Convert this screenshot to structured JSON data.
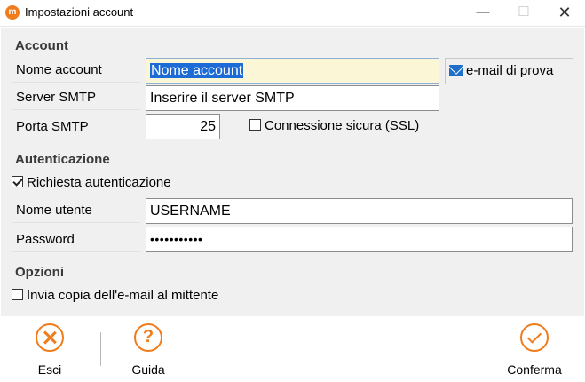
{
  "window": {
    "title": "Impostazioni account",
    "app_icon_glyph": "m",
    "minimize_glyph": "—",
    "maximize_glyph": "☐",
    "close_glyph": "✕"
  },
  "account": {
    "heading": "Account",
    "name_label": "Nome account",
    "name_value": "Nome account",
    "server_label": "Server SMTP",
    "server_value": "Inserire il server SMTP",
    "port_label": "Porta SMTP",
    "port_value": "25",
    "ssl_label": "Connessione sicura (SSL)",
    "ssl_checked": false,
    "test_button": "e-mail di prova"
  },
  "auth": {
    "heading": "Autenticazione",
    "required_label": "Richiesta autenticazione",
    "required_checked": true,
    "user_label": "Nome utente",
    "user_value": "USERNAME",
    "password_label": "Password",
    "password_value": "•••••••••••"
  },
  "options": {
    "heading": "Opzioni",
    "copy_label": "Invia copia dell'e-mail al mittente",
    "copy_checked": false
  },
  "footer": {
    "exit_label": "Esci",
    "help_label": "Guida",
    "help_glyph": "?",
    "confirm_label": "Conferma"
  },
  "colors": {
    "accent": "#f07c1c",
    "selection": "#1c6bd6",
    "client_bg": "#f0f0f0"
  }
}
